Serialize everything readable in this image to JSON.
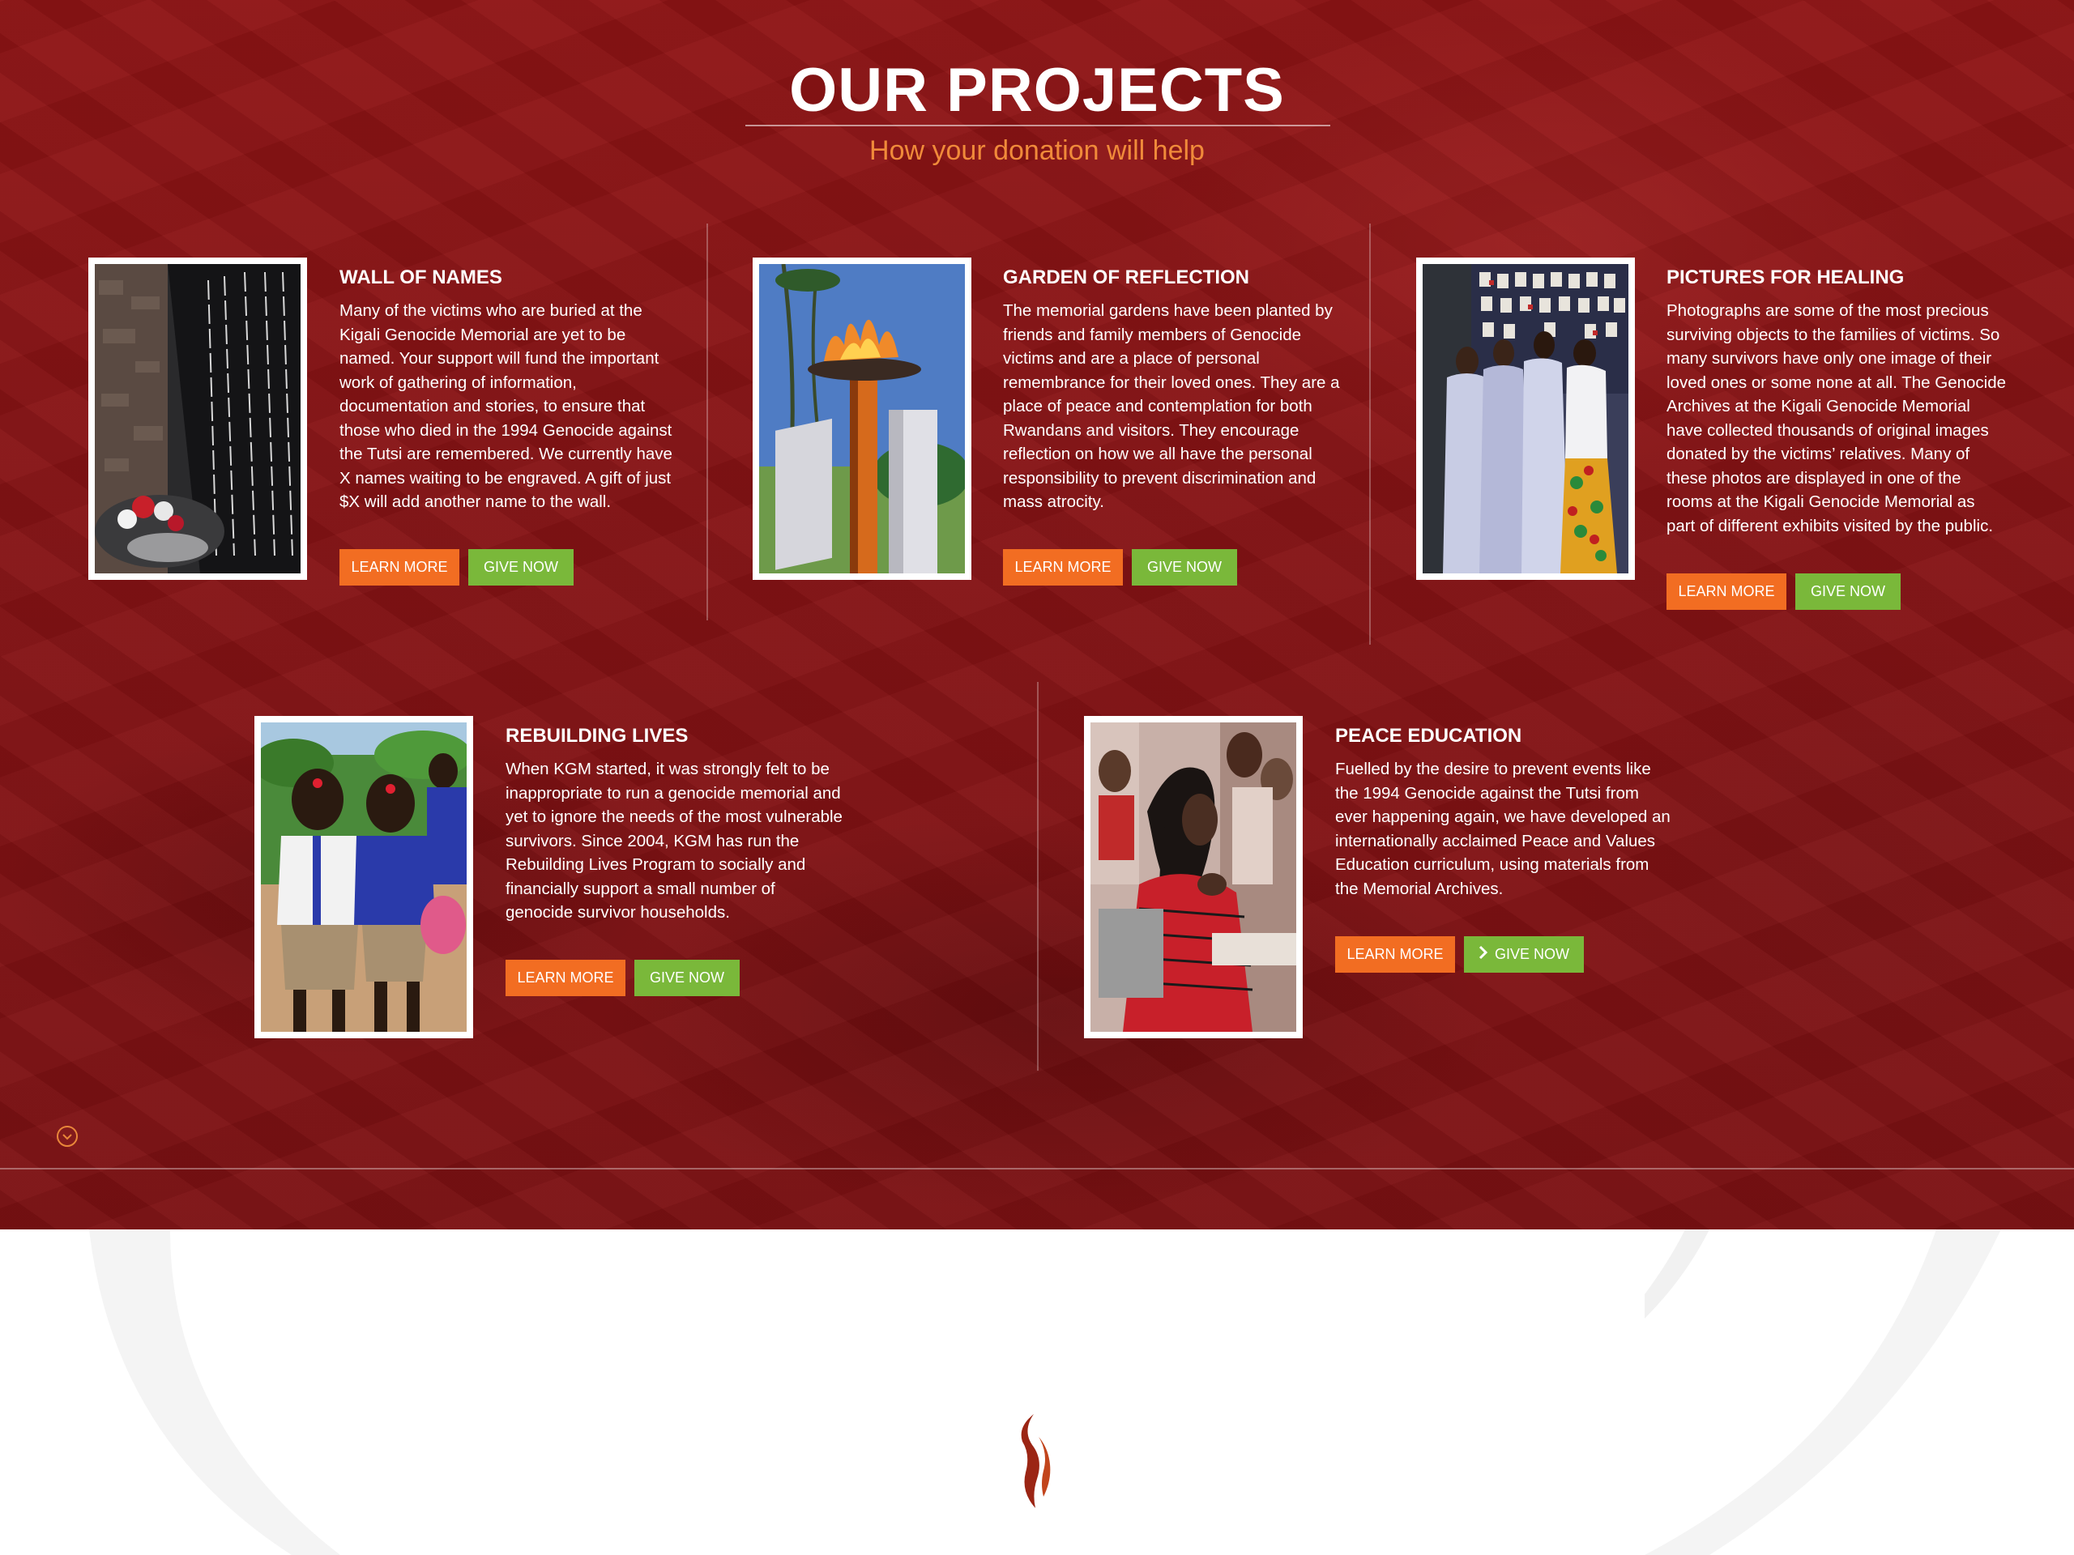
{
  "header": {
    "title": "OUR PROJECTS",
    "subtitle": "How your donation will help"
  },
  "projects": [
    {
      "title": "WALL OF NAMES",
      "description": "Many of the victims who are buried at the Kigali Genocide Memorial are yet to be named. Your support will fund the important work of gathering of information, documentation and stories, to ensure that those who died in the 1994 Genocide against the Tutsi are remembered. We currently have X names waiting to be engraved. A gift of just $X will add another name to the wall.",
      "learn_label": "LEARN MORE",
      "give_label": "GIVE NOW"
    },
    {
      "title": "GARDEN OF REFLECTION",
      "description": "The memorial gardens have been planted by friends and family members of Genocide victims and are a place of personal remembrance for their loved ones. They are a place of peace and contemplation for both Rwandans and visitors. They encourage reflection on how we all have the personal responsibility to prevent discrimination and mass atrocity.",
      "learn_label": "LEARN MORE",
      "give_label": "GIVE NOW"
    },
    {
      "title": "PICTURES FOR HEALING",
      "description": "Photographs are some of the most precious surviving objects to the families of victims. So many survivors have only one image of their loved ones or some none at all. The Genocide Archives at the Kigali Genocide Memorial have collected thousands of original images donated by the victims’ relatives. Many of these photos are displayed in one of the rooms at the Kigali Genocide Memorial as part of different exhibits visited by the public.",
      "learn_label": "LEARN MORE",
      "give_label": "GIVE NOW"
    },
    {
      "title": "REBUILDING LIVES",
      "description": "When KGM started, it was strongly felt to be inappropriate to run a genocide memorial and yet to ignore the needs of the most vulnerable survivors. Since 2004, KGM has run the Rebuilding Lives Program to socially and financially support a small number of genocide survivor households.",
      "learn_label": "LEARN MORE",
      "give_label": "GIVE NOW"
    },
    {
      "title": "PEACE EDUCATION",
      "description": "Fuelled by the desire to prevent events like the 1994 Genocide against the Tutsi from ever happening again, we have developed an internationally acclaimed Peace and Values Education curriculum, using materials from the Memorial Archives.",
      "learn_label": "LEARN MORE",
      "give_label": "GIVE NOW"
    }
  ],
  "icons": {
    "scroll_down": "chevron-down-circle-icon",
    "give_arrow": "chevron-right-icon",
    "logo": "flame-logo-icon"
  },
  "colors": {
    "background": "#8a1416",
    "accent_orange": "#f26d22",
    "accent_green": "#7ab83a",
    "subtitle": "#f08a3a",
    "logo": "#9b2514"
  }
}
